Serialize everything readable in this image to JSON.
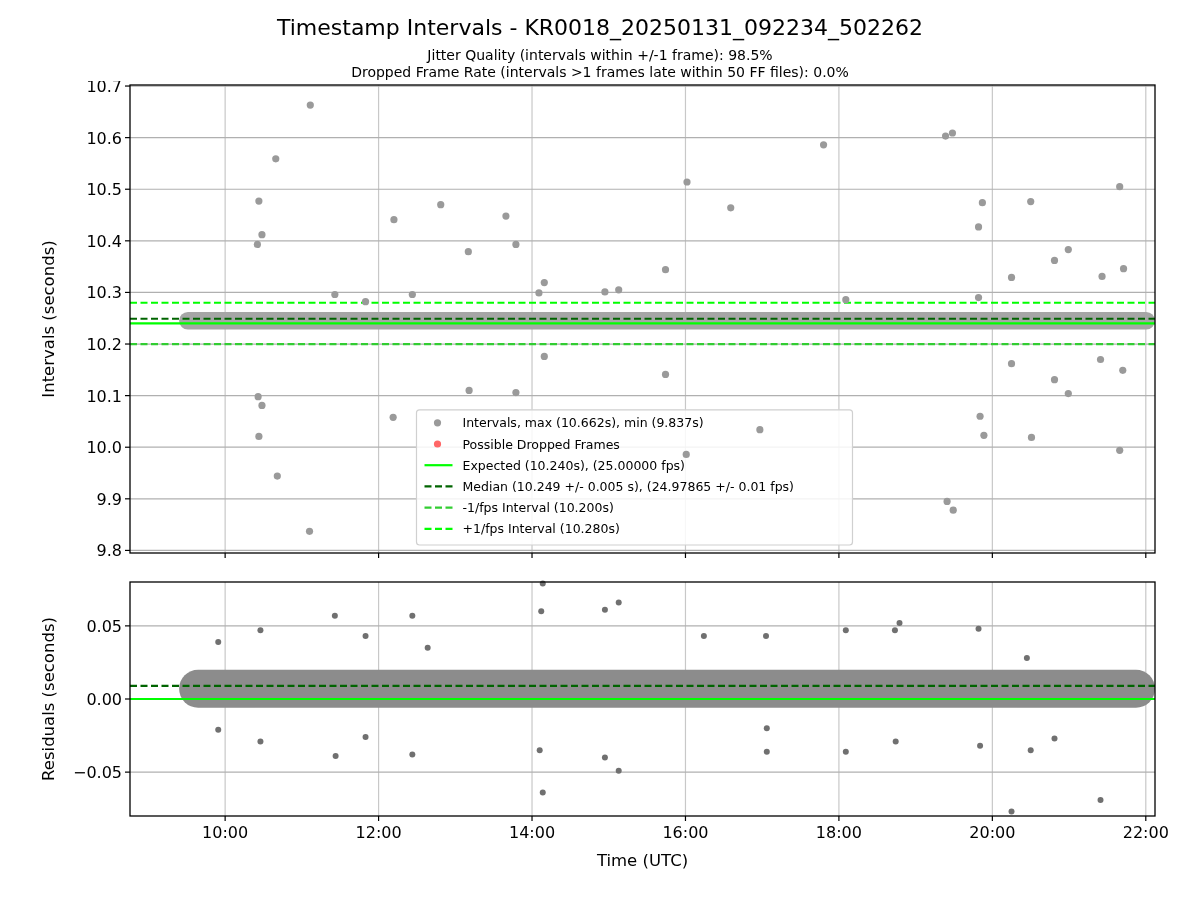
{
  "figure": {
    "title": "Timestamp Intervals - KR0018_20250131_092234_502262",
    "subtitle_lines": [
      "Jitter Quality (intervals within +/-1 frame): 98.5%",
      "Dropped Frame Rate (intervals >1 frames late within 50 FF files): 0.0%"
    ]
  },
  "panels": [
    {
      "chart_data": {
        "type": "scatter",
        "grid": true,
        "legend": "lower center",
        "ylabel": "Intervals (seconds)",
        "xlim": [
          8.76,
          22.12
        ],
        "ylim": [
          9.795,
          10.702
        ],
        "yticks": [
          {
            "value": 9.8,
            "label": "9.8"
          },
          {
            "value": 9.9,
            "label": "9.9"
          },
          {
            "value": 10.0,
            "label": "10.0"
          },
          {
            "value": 10.1,
            "label": "10.1"
          },
          {
            "value": 10.2,
            "label": "10.2"
          },
          {
            "value": 10.3,
            "label": "10.3"
          },
          {
            "value": 10.4,
            "label": "10.4"
          },
          {
            "value": 10.5,
            "label": "10.5"
          },
          {
            "value": 10.6,
            "label": "10.6"
          },
          {
            "value": 10.7,
            "label": "10.7"
          }
        ],
        "x": [
          10.42,
          10.44,
          10.48,
          10.43,
          10.48,
          10.44,
          10.68,
          10.66,
          11.11,
          11.1,
          11.43,
          11.83,
          12.2,
          12.19,
          12.44,
          12.81,
          13.17,
          13.18,
          13.66,
          13.79,
          13.79,
          14.16,
          14.09,
          14.16,
          14.95,
          15.13,
          15.74,
          15.74,
          16.02,
          16.01,
          16.59,
          16.97,
          17.8,
          18.09,
          19.39,
          19.48,
          19.41,
          19.49,
          19.82,
          19.82,
          19.87,
          19.84,
          19.89,
          20.25,
          20.25,
          20.5,
          20.51,
          20.81,
          20.81,
          20.99,
          20.99,
          21.43,
          21.41,
          21.66,
          21.71,
          21.7,
          21.66
        ],
        "series": [
          {
            "name": "Intervals, max (10.662s), min (9.837s)",
            "color": "#9a9a9a",
            "values": [
              10.393,
              10.477,
              10.412,
              10.098,
              10.081,
              10.021,
              9.944,
              10.559,
              10.663,
              9.837,
              10.296,
              10.282,
              10.441,
              10.058,
              10.296,
              10.47,
              10.379,
              10.11,
              10.448,
              10.393,
              10.106,
              10.319,
              10.299,
              10.176,
              10.301,
              10.305,
              10.344,
              10.141,
              10.514,
              9.986,
              10.464,
              10.034,
              10.586,
              10.286,
              10.603,
              10.609,
              9.895,
              9.878,
              10.29,
              10.427,
              10.474,
              10.06,
              10.023,
              10.329,
              10.162,
              10.476,
              10.019,
              10.362,
              10.131,
              10.383,
              10.104,
              10.331,
              10.17,
              10.505,
              10.346,
              10.149,
              9.994
            ]
          },
          {
            "name": "Possible Dropped Frames",
            "color": "#ff6666",
            "values": [
              null,
              null,
              null,
              null,
              null,
              null,
              null,
              null,
              null,
              null,
              null,
              null,
              null,
              null,
              null,
              null,
              null,
              null,
              null,
              null,
              null,
              null,
              null,
              null,
              null,
              null,
              null,
              null,
              null,
              null,
              null,
              null,
              null,
              null,
              null,
              null,
              null,
              null,
              null,
              null,
              null,
              null,
              null,
              null,
              null,
              null,
              null,
              null,
              null,
              null,
              null,
              null,
              null,
              null,
              null,
              null,
              null
            ]
          }
        ],
        "ref_lines": [
          {
            "axis": "y",
            "value": 10.24,
            "label": "Expected (10.240s), (25.00000 fps)",
            "color": "#00ff00"
          },
          {
            "axis": "y",
            "value": 10.249,
            "label": "Median (10.249 +/- 0.005 s), (24.97865 +/- 0.01 fps)",
            "color": "#006400"
          },
          {
            "axis": "y",
            "value": 10.2,
            "label": "-1/fps Interval (10.200s)",
            "color": "#32cd32"
          },
          {
            "axis": "y",
            "value": 10.28,
            "label": "+1/fps Interval (10.280s)",
            "color": "#00ff00"
          }
        ],
        "bands": [
          {
            "axis": "y",
            "from": 10.228,
            "to": 10.262,
            "color": "#a6a6a6"
          }
        ]
      }
    },
    {
      "chart_data": {
        "type": "scatter",
        "grid": true,
        "xlabel": "Time (UTC)",
        "ylabel": "Residuals (seconds)",
        "xlim": [
          8.76,
          22.12
        ],
        "ylim": [
          -0.08,
          0.08
        ],
        "xticks": [
          {
            "value": 10,
            "label": "10:00"
          },
          {
            "value": 12,
            "label": "12:00"
          },
          {
            "value": 14,
            "label": "14:00"
          },
          {
            "value": 16,
            "label": "16:00"
          },
          {
            "value": 18,
            "label": "18:00"
          },
          {
            "value": 20,
            "label": "20:00"
          },
          {
            "value": 22,
            "label": "22:00"
          }
        ],
        "yticks": [
          {
            "value": -0.05,
            "label": "−0.05"
          },
          {
            "value": 0,
            "label": "0.00"
          },
          {
            "value": 0.05,
            "label": "0.05"
          }
        ],
        "x": [
          9.91,
          9.91,
          10.46,
          10.46,
          11.43,
          11.44,
          11.83,
          11.83,
          12.44,
          12.44,
          12.64,
          14.12,
          14.14,
          14.1,
          14.14,
          14.95,
          14.95,
          15.13,
          15.13,
          16.24,
          17.05,
          17.06,
          17.06,
          18.09,
          18.09,
          18.73,
          18.79,
          18.74,
          19.82,
          19.84,
          20.25,
          20.45,
          20.5,
          20.81,
          21.41
        ],
        "series": [
          {
            "color": "#707070",
            "values": [
              0.039,
              -0.021,
              0.047,
              -0.029,
              0.057,
              -0.039,
              0.043,
              -0.026,
              0.057,
              -0.038,
              0.035,
              0.06,
              0.079,
              -0.035,
              -0.064,
              0.061,
              -0.04,
              0.066,
              -0.049,
              0.043,
              0.043,
              -0.036,
              -0.02,
              0.047,
              -0.036,
              0.047,
              0.052,
              -0.029,
              0.048,
              -0.032,
              -0.077,
              0.028,
              -0.035,
              -0.027,
              -0.069
            ]
          }
        ],
        "ref_lines": [
          {
            "axis": "y",
            "value": 0,
            "color": "#00ff00"
          },
          {
            "axis": "y",
            "value": 0.009,
            "color": "#006400"
          }
        ],
        "bands": [
          {
            "axis": "y",
            "from": -0.006,
            "to": 0.02,
            "color": "#8c8c8c"
          }
        ]
      }
    }
  ]
}
